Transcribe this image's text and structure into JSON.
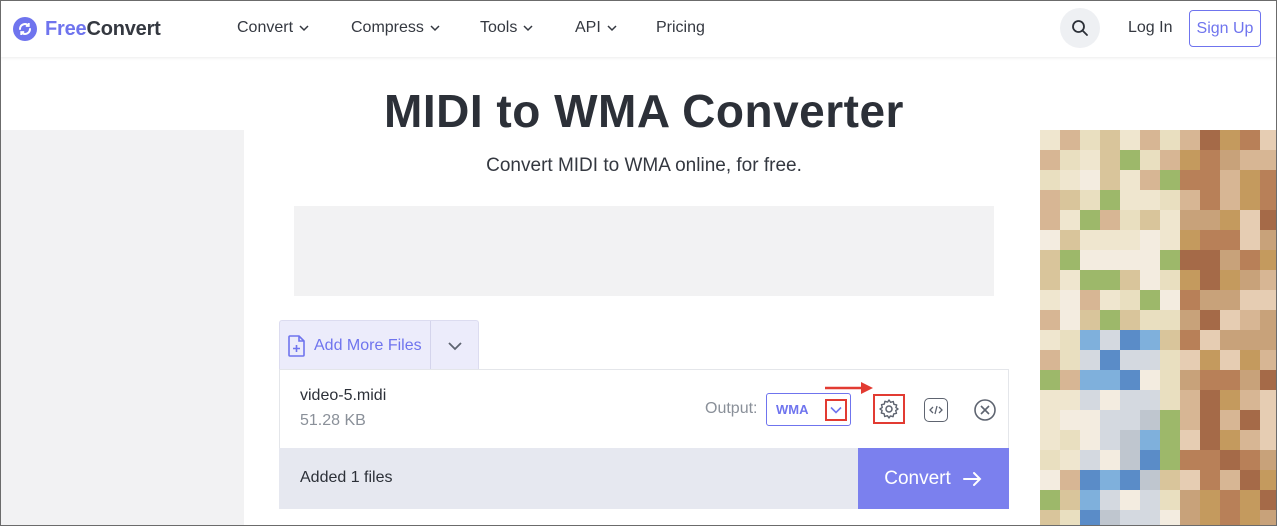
{
  "brand": {
    "logo_free": "Free",
    "logo_convert": "Convert",
    "accent": "#6f74ee",
    "annotation_color": "#e23b32"
  },
  "nav": {
    "items": [
      {
        "label": "Convert",
        "icon": "chevron-down-icon"
      },
      {
        "label": "Compress",
        "icon": "chevron-down-icon"
      },
      {
        "label": "Tools",
        "icon": "chevron-down-icon"
      },
      {
        "label": "API",
        "icon": "chevron-down-icon"
      },
      {
        "label": "Pricing"
      }
    ],
    "search_icon": "search-icon",
    "login": "Log In",
    "signup": "Sign Up"
  },
  "main": {
    "title": "MIDI to WMA Converter",
    "subtitle": "Convert MIDI to WMA online, for free."
  },
  "uploader": {
    "add_more_label": "Add More Files",
    "add_more_icon": "file-plus-icon",
    "dropdown_icon": "chevron-down-icon"
  },
  "file": {
    "name": "video-5.midi",
    "size": "51.28 KB",
    "output_label": "Output:",
    "format": "WMA",
    "settings_icon": "gear-icon",
    "embed_icon": "code-icon",
    "remove_icon": "close-circle-icon"
  },
  "footer": {
    "added_text": "Added 1 files",
    "convert_label": "Convert",
    "convert_icon": "arrow-right-icon"
  }
}
